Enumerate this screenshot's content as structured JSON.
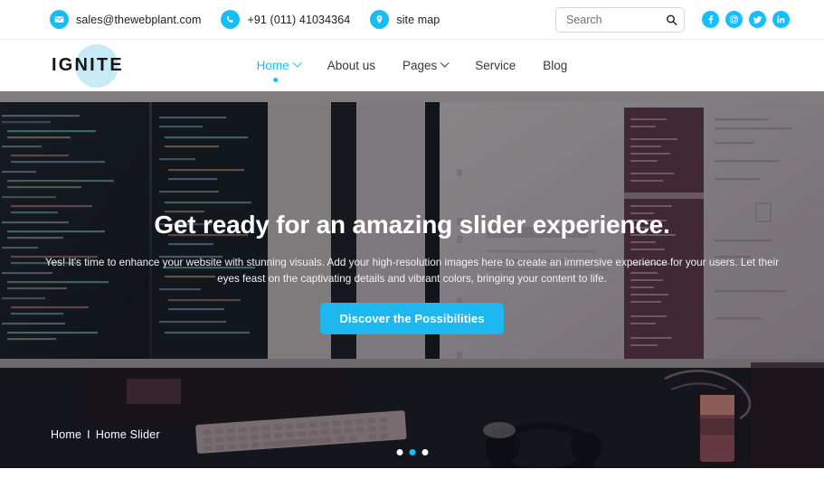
{
  "topbar": {
    "contacts": [
      {
        "icon": "envelope-icon",
        "text": "sales@thewebplant.com",
        "name": "contact-email"
      },
      {
        "icon": "phone-icon",
        "text": "+91 (011) 41034364",
        "name": "contact-phone"
      },
      {
        "icon": "location-pin-icon",
        "text": "site map",
        "name": "contact-sitemap"
      }
    ],
    "search": {
      "placeholder": "Search",
      "value": "",
      "icon": "search-icon"
    },
    "socials": [
      {
        "name": "facebook-icon",
        "label": "Facebook"
      },
      {
        "name": "instagram-icon",
        "label": "Instagram"
      },
      {
        "name": "twitter-icon",
        "label": "Twitter"
      },
      {
        "name": "linkedin-icon",
        "label": "LinkedIn"
      }
    ]
  },
  "header": {
    "logo": "IGNITE",
    "nav": [
      {
        "label": "Home",
        "active": true,
        "caret": true
      },
      {
        "label": "About us",
        "active": false,
        "caret": false
      },
      {
        "label": "Pages",
        "active": false,
        "caret": true
      },
      {
        "label": "Service",
        "active": false,
        "caret": false
      },
      {
        "label": "Blog",
        "active": false,
        "caret": false
      }
    ]
  },
  "hero": {
    "title": "Get ready for an amazing slider experience.",
    "subtitle": "Yes! It's time to enhance your website with stunning visuals. Add your high-resolution images here to create an immersive experience for your users. Let their eyes feast on the captivating details and vibrant colors, bringing your content to life.",
    "cta": "Discover the Possibilities",
    "breadcrumb": {
      "home": "Home",
      "separator": "I",
      "current": "Home Slider"
    },
    "slides": {
      "count": 3,
      "active_index": 1
    }
  },
  "colors": {
    "brand_cyan": "#17beff",
    "cta_blue": "#1db8f0",
    "logo_blob": "#c8eaf7",
    "text_dark": "#32373c"
  }
}
